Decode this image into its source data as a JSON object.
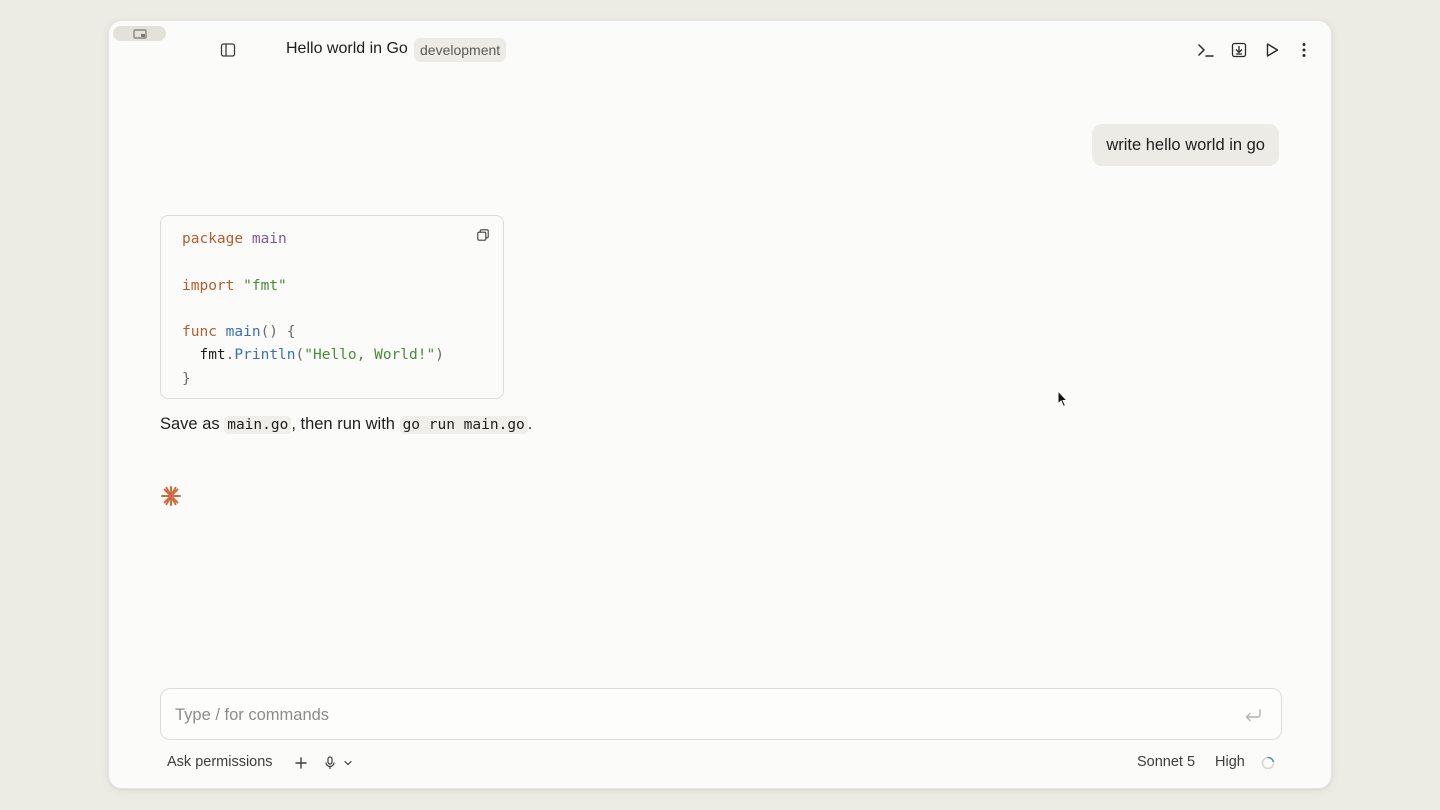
{
  "window": {
    "title": "Hello world in Go",
    "tag": "development"
  },
  "toolbar": {
    "icons": [
      "terminal-icon",
      "download-icon",
      "play-icon",
      "more-vertical-icon"
    ]
  },
  "conversation": {
    "user_message": "write hello world in go",
    "code": {
      "language": "go",
      "lines": [
        [
          "package",
          "main"
        ],
        [
          "import",
          "\"fmt\""
        ],
        [
          "func",
          "main",
          "() {"
        ],
        [
          "fmt",
          ".",
          "Println",
          "(",
          "\"Hello, World!\"",
          ")"
        ],
        [
          "}"
        ]
      ]
    },
    "answer": {
      "prefix": "Save as ",
      "code1": "main.go",
      "middle": ", then run with ",
      "code2": "go run main.go",
      "suffix": "."
    }
  },
  "composer": {
    "placeholder": "Type / for commands",
    "value": ""
  },
  "footer": {
    "permissions_label": "Ask permissions",
    "model_label": "Sonnet 5",
    "effort_label": "High"
  },
  "colors": {
    "accent": "#d2693f",
    "keyword": "#b65c2e",
    "package_name": "#8056a6",
    "string": "#4a8b3a",
    "function": "#3c6fb7"
  }
}
